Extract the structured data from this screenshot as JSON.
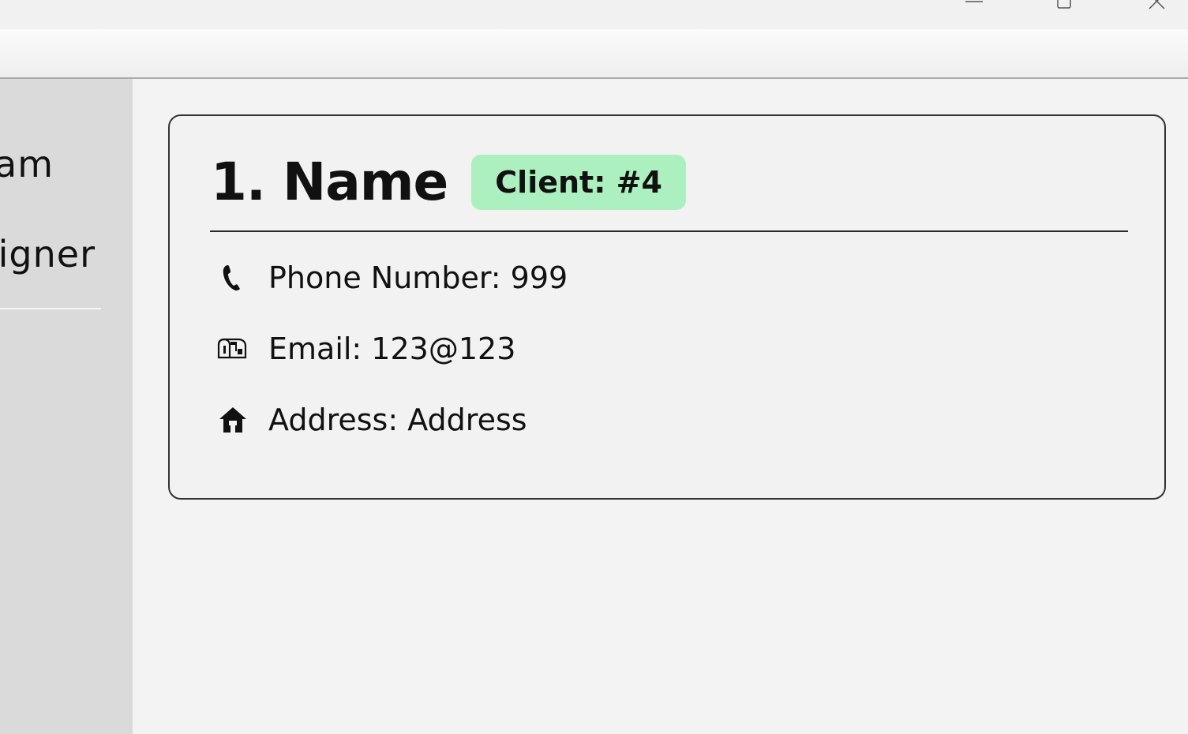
{
  "window": {
    "controls": [
      "minimize-icon",
      "maximize-icon",
      "close-icon"
    ]
  },
  "sidebar": {
    "items": [
      {
        "label": "am"
      },
      {
        "label": "igner"
      }
    ]
  },
  "client_card": {
    "title": "1. Name",
    "badge": "Client: #4",
    "badge_color": "#adf0bf",
    "phone": {
      "icon": "phone-icon",
      "text": "Phone Number: 999"
    },
    "email": {
      "icon": "mailbox-icon",
      "text": "Email: 123@123"
    },
    "address": {
      "icon": "home-icon",
      "text": "Address: Address"
    }
  }
}
